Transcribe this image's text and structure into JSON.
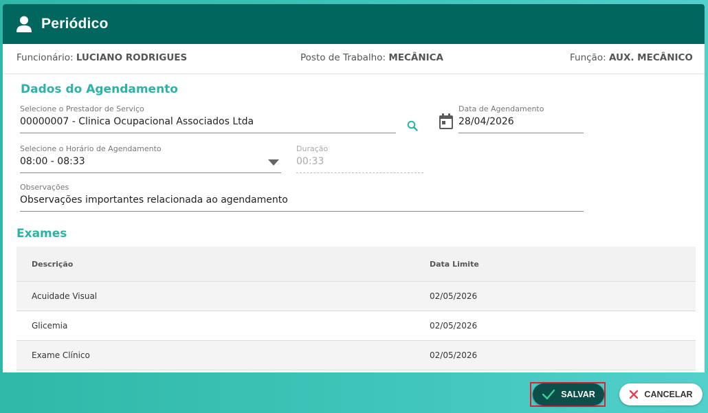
{
  "header": {
    "title": "Periódico",
    "icon": "user-icon"
  },
  "info": {
    "employee_label": "Funcionário:",
    "employee_value": "LUCIANO RODRIGUES",
    "workstation_label": "Posto de Trabalho:",
    "workstation_value": "MECÂNICA",
    "role_label": "Função:",
    "role_value": "AUX. MECÂNICO"
  },
  "scheduling": {
    "title": "Dados do Agendamento",
    "provider_label": "Selecione o Prestador de Serviço",
    "provider_value": "00000007 - Clinica Ocupacional Associados Ltda",
    "date_label": "Data de Agendamento",
    "date_value": "28/04/2026",
    "time_label": "Selecione o Horário de Agendamento",
    "time_value": "08:00 - 08:33",
    "duration_label": "Duração",
    "duration_value": "00:33",
    "notes_label": "Observações",
    "notes_value": "Observações importantes relacionada ao agendamento"
  },
  "exams": {
    "title": "Exames",
    "columns": [
      "Descrição",
      "Data Limite"
    ],
    "rows": [
      [
        "Acuidade Visual",
        "02/05/2026"
      ],
      [
        "Glicemia",
        "02/05/2026"
      ],
      [
        "Exame Clínico",
        "02/05/2026"
      ]
    ]
  },
  "actions": {
    "save_label": "SALVAR",
    "cancel_label": "CANCELAR"
  },
  "colors": {
    "header": "#00665e",
    "accent": "#2bb3a6",
    "save": "#0c4f4a",
    "cancel_x": "#e04050"
  }
}
